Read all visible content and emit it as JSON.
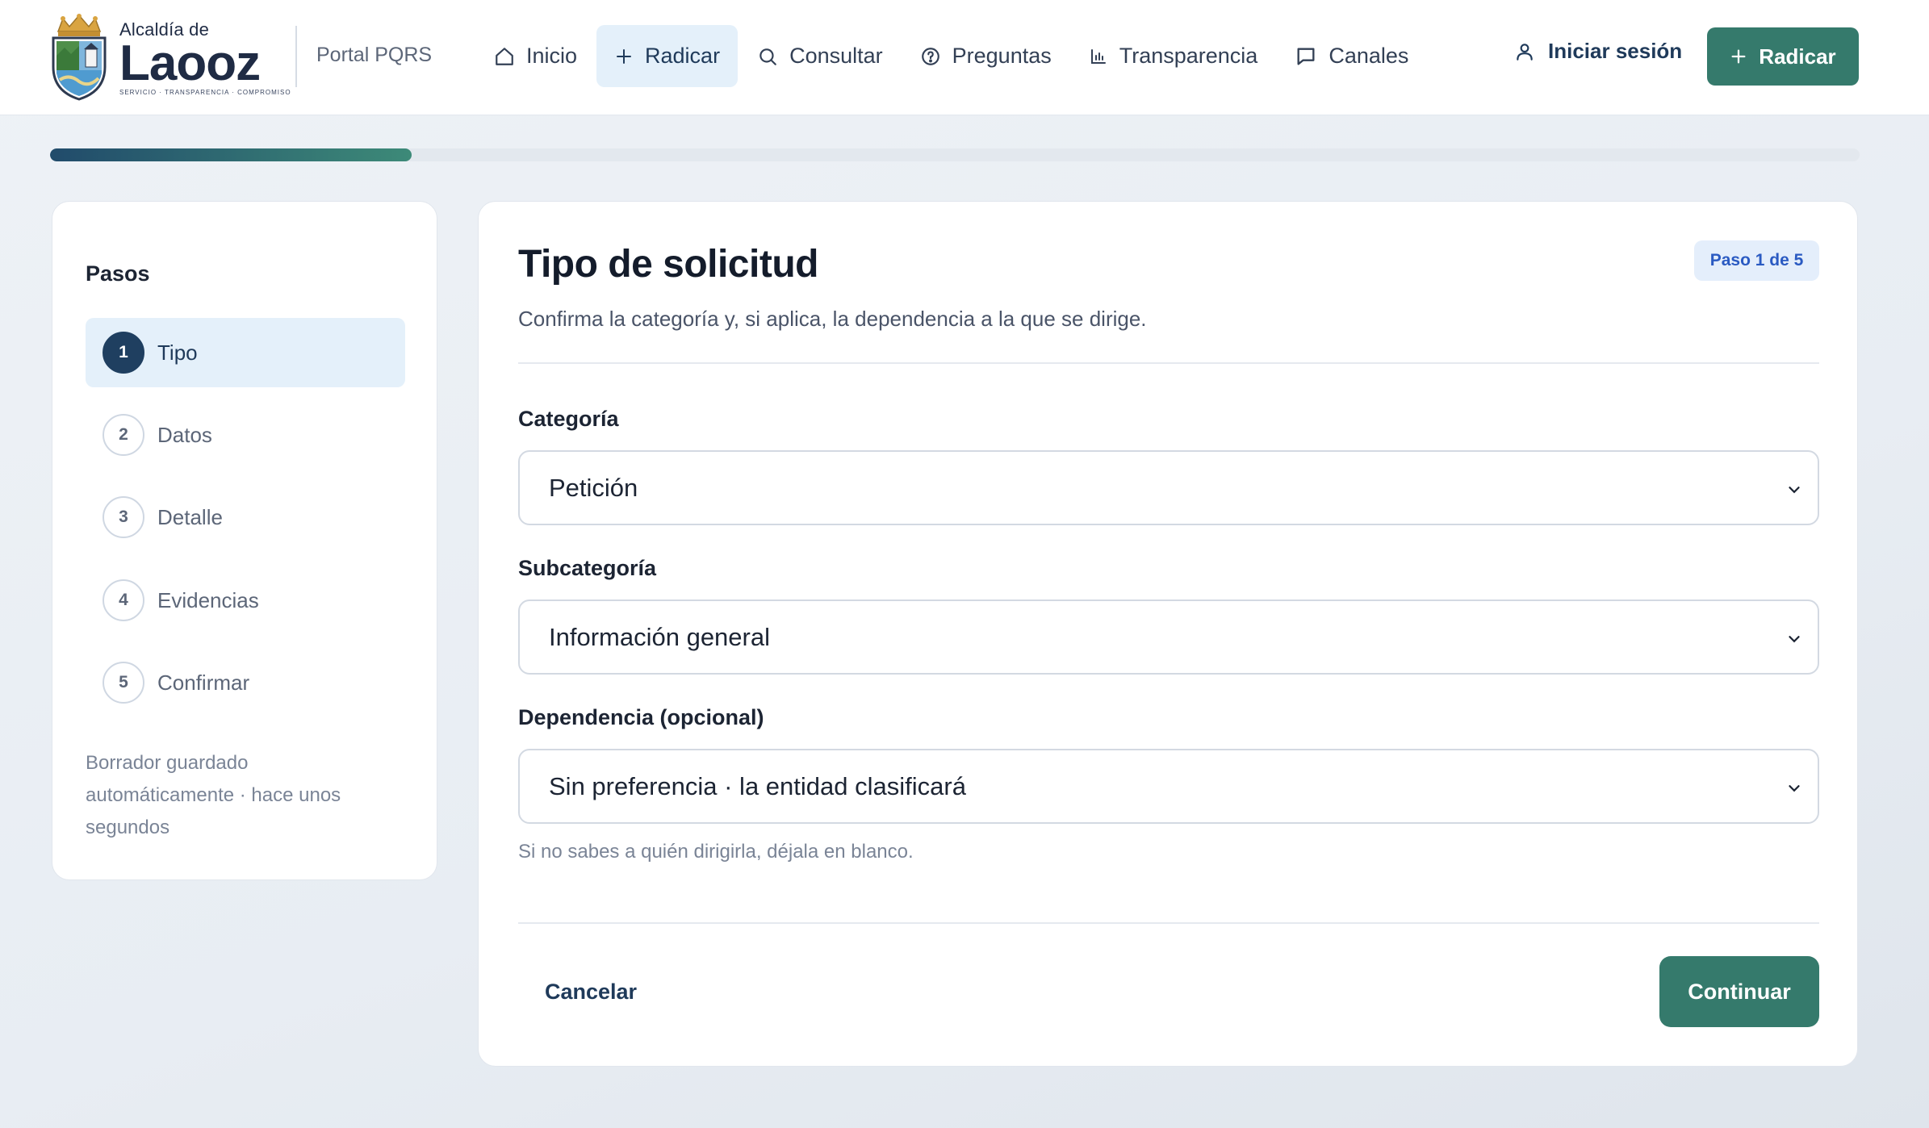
{
  "brand": {
    "pre": "Alcaldía de",
    "name": "Laooz",
    "tagline": "SERVICIO · TRANSPARENCIA · COMPROMISO",
    "portal": "Portal PQRS"
  },
  "nav": {
    "items": [
      {
        "label": "Inicio",
        "icon": "home-icon"
      },
      {
        "label": "Radicar",
        "icon": "plus-icon",
        "active": true
      },
      {
        "label": "Consultar",
        "icon": "search-icon"
      },
      {
        "label": "Preguntas",
        "icon": "help-circle-icon"
      },
      {
        "label": "Transparencia",
        "icon": "bar-chart-icon"
      },
      {
        "label": "Canales",
        "icon": "chat-icon"
      }
    ],
    "login": "Iniciar sesión",
    "cta": "Radicar"
  },
  "progress": {
    "fraction": 0.2
  },
  "sidebar": {
    "title": "Pasos",
    "steps": [
      {
        "num": "1",
        "label": "Tipo"
      },
      {
        "num": "2",
        "label": "Datos"
      },
      {
        "num": "3",
        "label": "Detalle"
      },
      {
        "num": "4",
        "label": "Evidencias"
      },
      {
        "num": "5",
        "label": "Confirmar"
      }
    ],
    "active_step": 1,
    "draft_note": "Borrador guardado automáticamente · hace unos segundos"
  },
  "form": {
    "title": "Tipo de solicitud",
    "badge": "Paso 1 de 5",
    "description": "Confirma la categoría y, si aplica, la dependencia a la que se dirige.",
    "category": {
      "label": "Categoría",
      "value": "Petición"
    },
    "subcategory": {
      "label": "Subcategoría",
      "value": "Información general"
    },
    "dependency": {
      "label": "Dependencia (opcional)",
      "value": "Sin preferencia · la entidad clasificará"
    },
    "hint": "Si no sabes a quién dirigirla, déjala en blanco.",
    "cancel": "Cancelar",
    "continue": "Continuar"
  },
  "colors": {
    "accent": "#357a6c",
    "navy": "#1f3f60",
    "active_bg": "#e4f0fa",
    "badge_text": "#2a5ac2"
  }
}
